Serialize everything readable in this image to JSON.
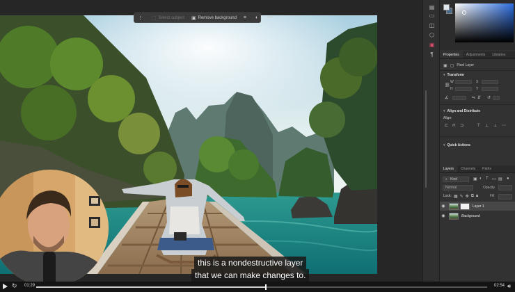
{
  "task_bar": {
    "select_subject": "Select subject",
    "remove_background": "Remove background"
  },
  "subtitles": {
    "line1": "this is a nondestructive layer",
    "line2": "that we can make changes to."
  },
  "panels": {
    "properties_tabs": [
      "Properties",
      "Adjustments",
      "Libraries"
    ],
    "pixel_layer_label": "Pixel Layer",
    "transform_title": "Transform",
    "align_title": "Align and Distribute",
    "align_label": "Align:",
    "quick_actions_title": "Quick Actions",
    "layers_tabs": [
      "Layers",
      "Channels",
      "Paths"
    ],
    "kind_label": "Kind",
    "blend_mode": "Normal",
    "opacity_label": "Opacity",
    "lock_label": "Lock:",
    "fill_label": "Fill",
    "layers": [
      {
        "name": "Layer 1",
        "selected": true
      },
      {
        "name": "Background",
        "selected": false
      }
    ]
  },
  "player": {
    "current_time": "01:29",
    "total_time": "02:54",
    "progress": 0.51
  },
  "icons": {
    "play": "play-icon",
    "replay": "replay-icon",
    "volume": "volume-icon",
    "more": "more-dots-icon"
  },
  "colors": {
    "accent_blue": "#2d6de0",
    "panel_bg": "#323232",
    "subtitle_bg": "#191919"
  }
}
